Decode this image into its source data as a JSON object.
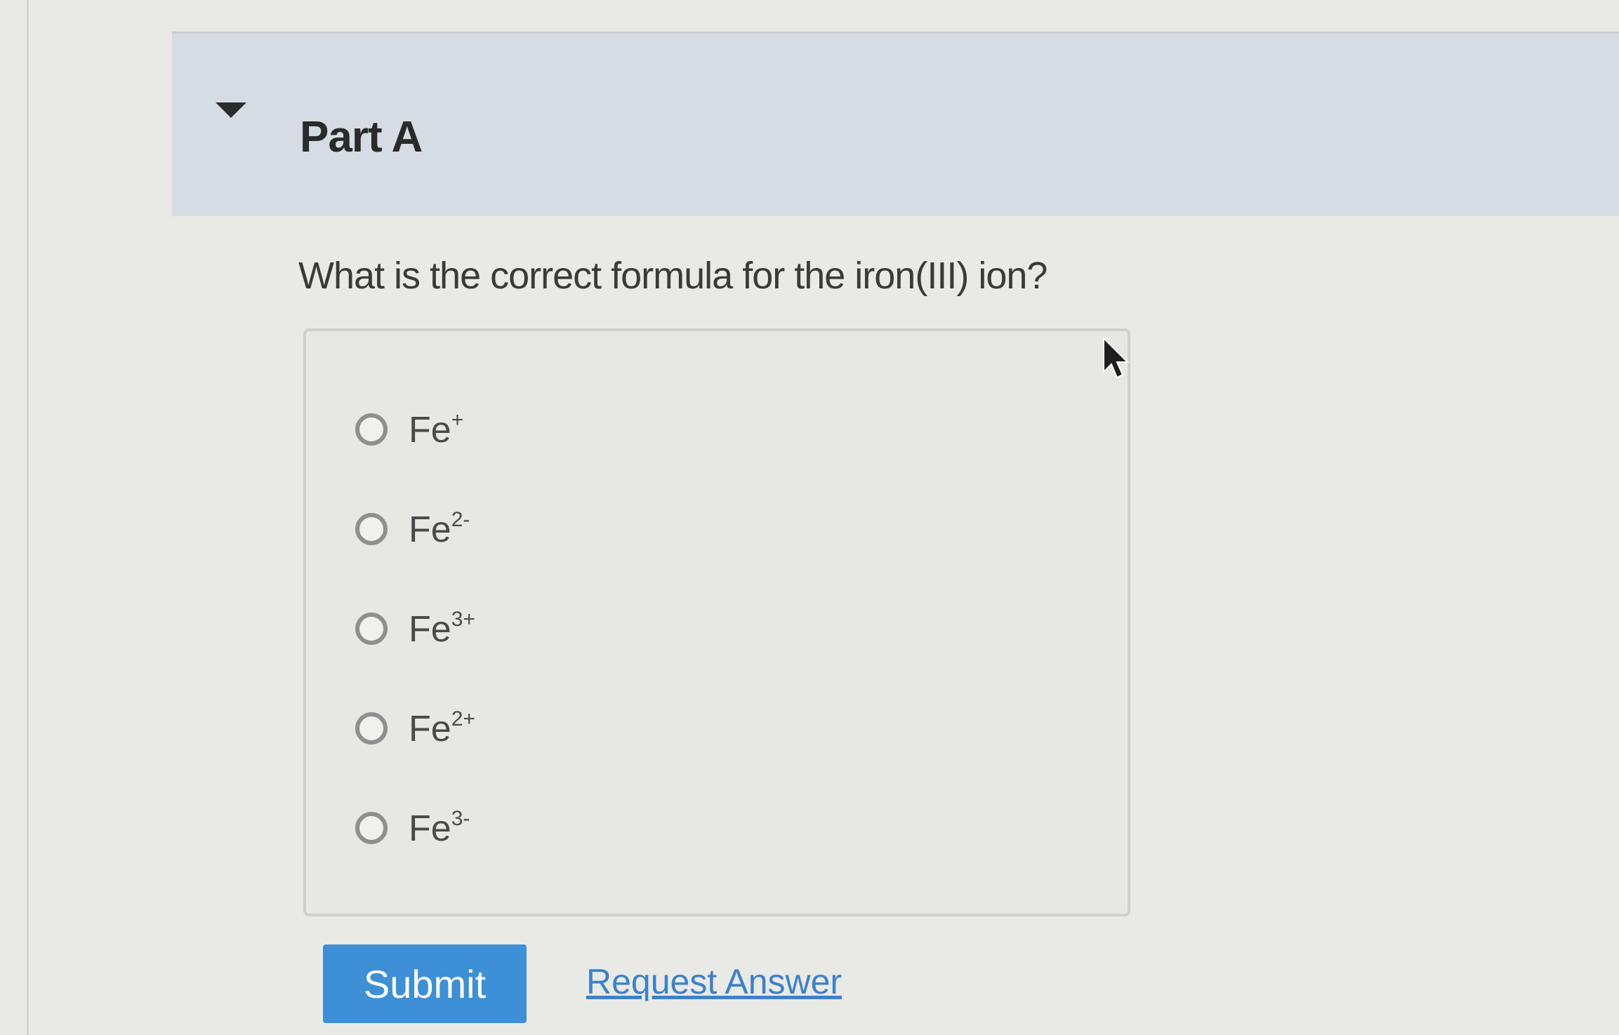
{
  "part": {
    "title": "Part A"
  },
  "question": {
    "text": "What is the correct formula for the iron(III) ion?"
  },
  "choices": [
    {
      "base": "Fe",
      "charge": "+"
    },
    {
      "base": "Fe",
      "charge": "2-"
    },
    {
      "base": "Fe",
      "charge": "3+"
    },
    {
      "base": "Fe",
      "charge": "2+"
    },
    {
      "base": "Fe",
      "charge": "3-"
    }
  ],
  "actions": {
    "submit_label": "Submit",
    "request_answer_label": "Request Answer"
  },
  "colors": {
    "header_bg": "#d6dce3",
    "submit_bg": "#3d8fd6",
    "link": "#3d82c9"
  }
}
